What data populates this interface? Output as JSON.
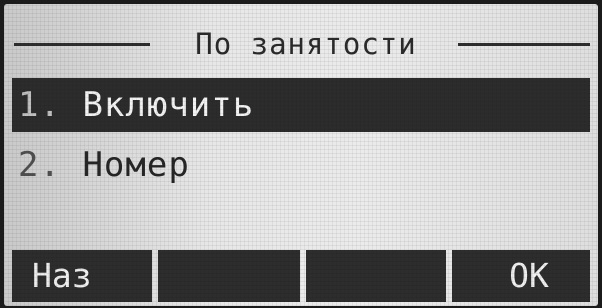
{
  "screen": {
    "title": "По занятости"
  },
  "menu": {
    "items": [
      {
        "number": "1.",
        "label": "Включить",
        "selected": true
      },
      {
        "number": "2.",
        "label": "Номер",
        "selected": false
      }
    ]
  },
  "softkeys": [
    {
      "label": "Наз"
    },
    {
      "label": ""
    },
    {
      "label": ""
    },
    {
      "label": "ОК"
    }
  ]
}
